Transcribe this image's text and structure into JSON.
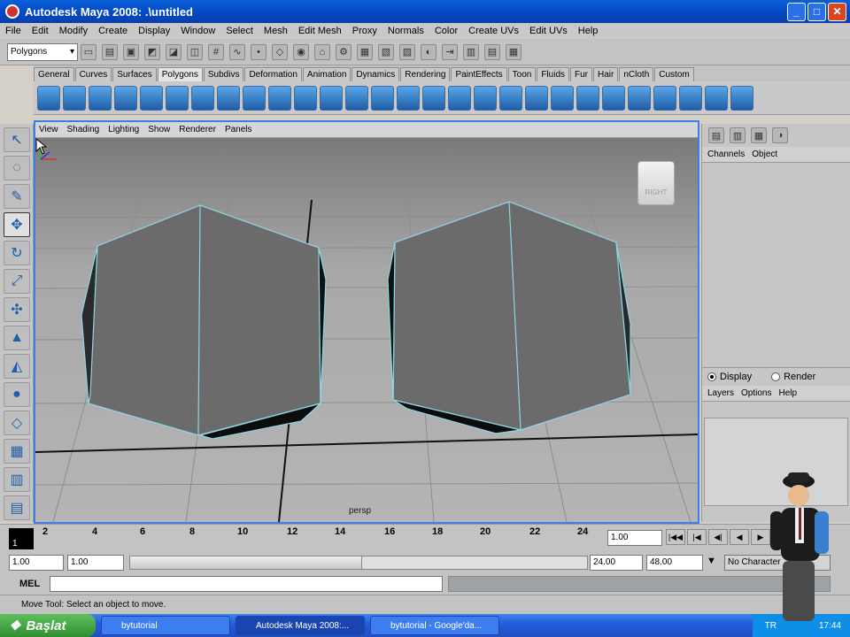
{
  "window": {
    "title": "Autodesk Maya 2008: .\\untitled",
    "min": "_",
    "max": "□",
    "close": "✕"
  },
  "menu": [
    "File",
    "Edit",
    "Modify",
    "Create",
    "Display",
    "Window",
    "Select",
    "Mesh",
    "Edit Mesh",
    "Proxy",
    "Normals",
    "Color",
    "Create UVs",
    "Edit UVs",
    "Help"
  ],
  "statusline": {
    "mode": "Polygons",
    "dropdown_icon": "chevron-down-icon"
  },
  "shelf": {
    "tabs": [
      "General",
      "Curves",
      "Surfaces",
      "Polygons",
      "Subdivs",
      "Deformation",
      "Animation",
      "Dynamics",
      "Rendering",
      "PaintEffects",
      "Toon",
      "Fluids",
      "Fur",
      "Hair",
      "nCloth",
      "Custom"
    ],
    "active_tab": "Polygons"
  },
  "panel": {
    "menu": [
      "View",
      "Shading",
      "Lighting",
      "Show",
      "Renderer",
      "Panels"
    ],
    "camera": "persp",
    "viewcube": "RIGHT"
  },
  "channelbox": {
    "menu": [
      "Channels",
      "Object"
    ]
  },
  "layers": {
    "display": "Display",
    "render": "Render",
    "menu": [
      "Layers",
      "Options",
      "Help"
    ]
  },
  "timeline": {
    "current": "1",
    "ticks": [
      "2",
      "4",
      "6",
      "8",
      "10",
      "12",
      "14",
      "16",
      "18",
      "20",
      "22",
      "24"
    ],
    "current_frame_field": "1.00"
  },
  "range": {
    "start": "1.00",
    "inner_start": "1.00",
    "inner_end": "24.00",
    "end": "48.00",
    "character": "No Character"
  },
  "cmdline": {
    "label": "MEL"
  },
  "helpline": {
    "text": "Move Tool: Select an object to move."
  },
  "taskbar": {
    "start": "Başlat",
    "tasks": [
      "bytutorial",
      "Autodesk Maya 2008:...",
      "bytutorial - Google'da..."
    ],
    "lang": "TR",
    "clock": "17:44"
  }
}
